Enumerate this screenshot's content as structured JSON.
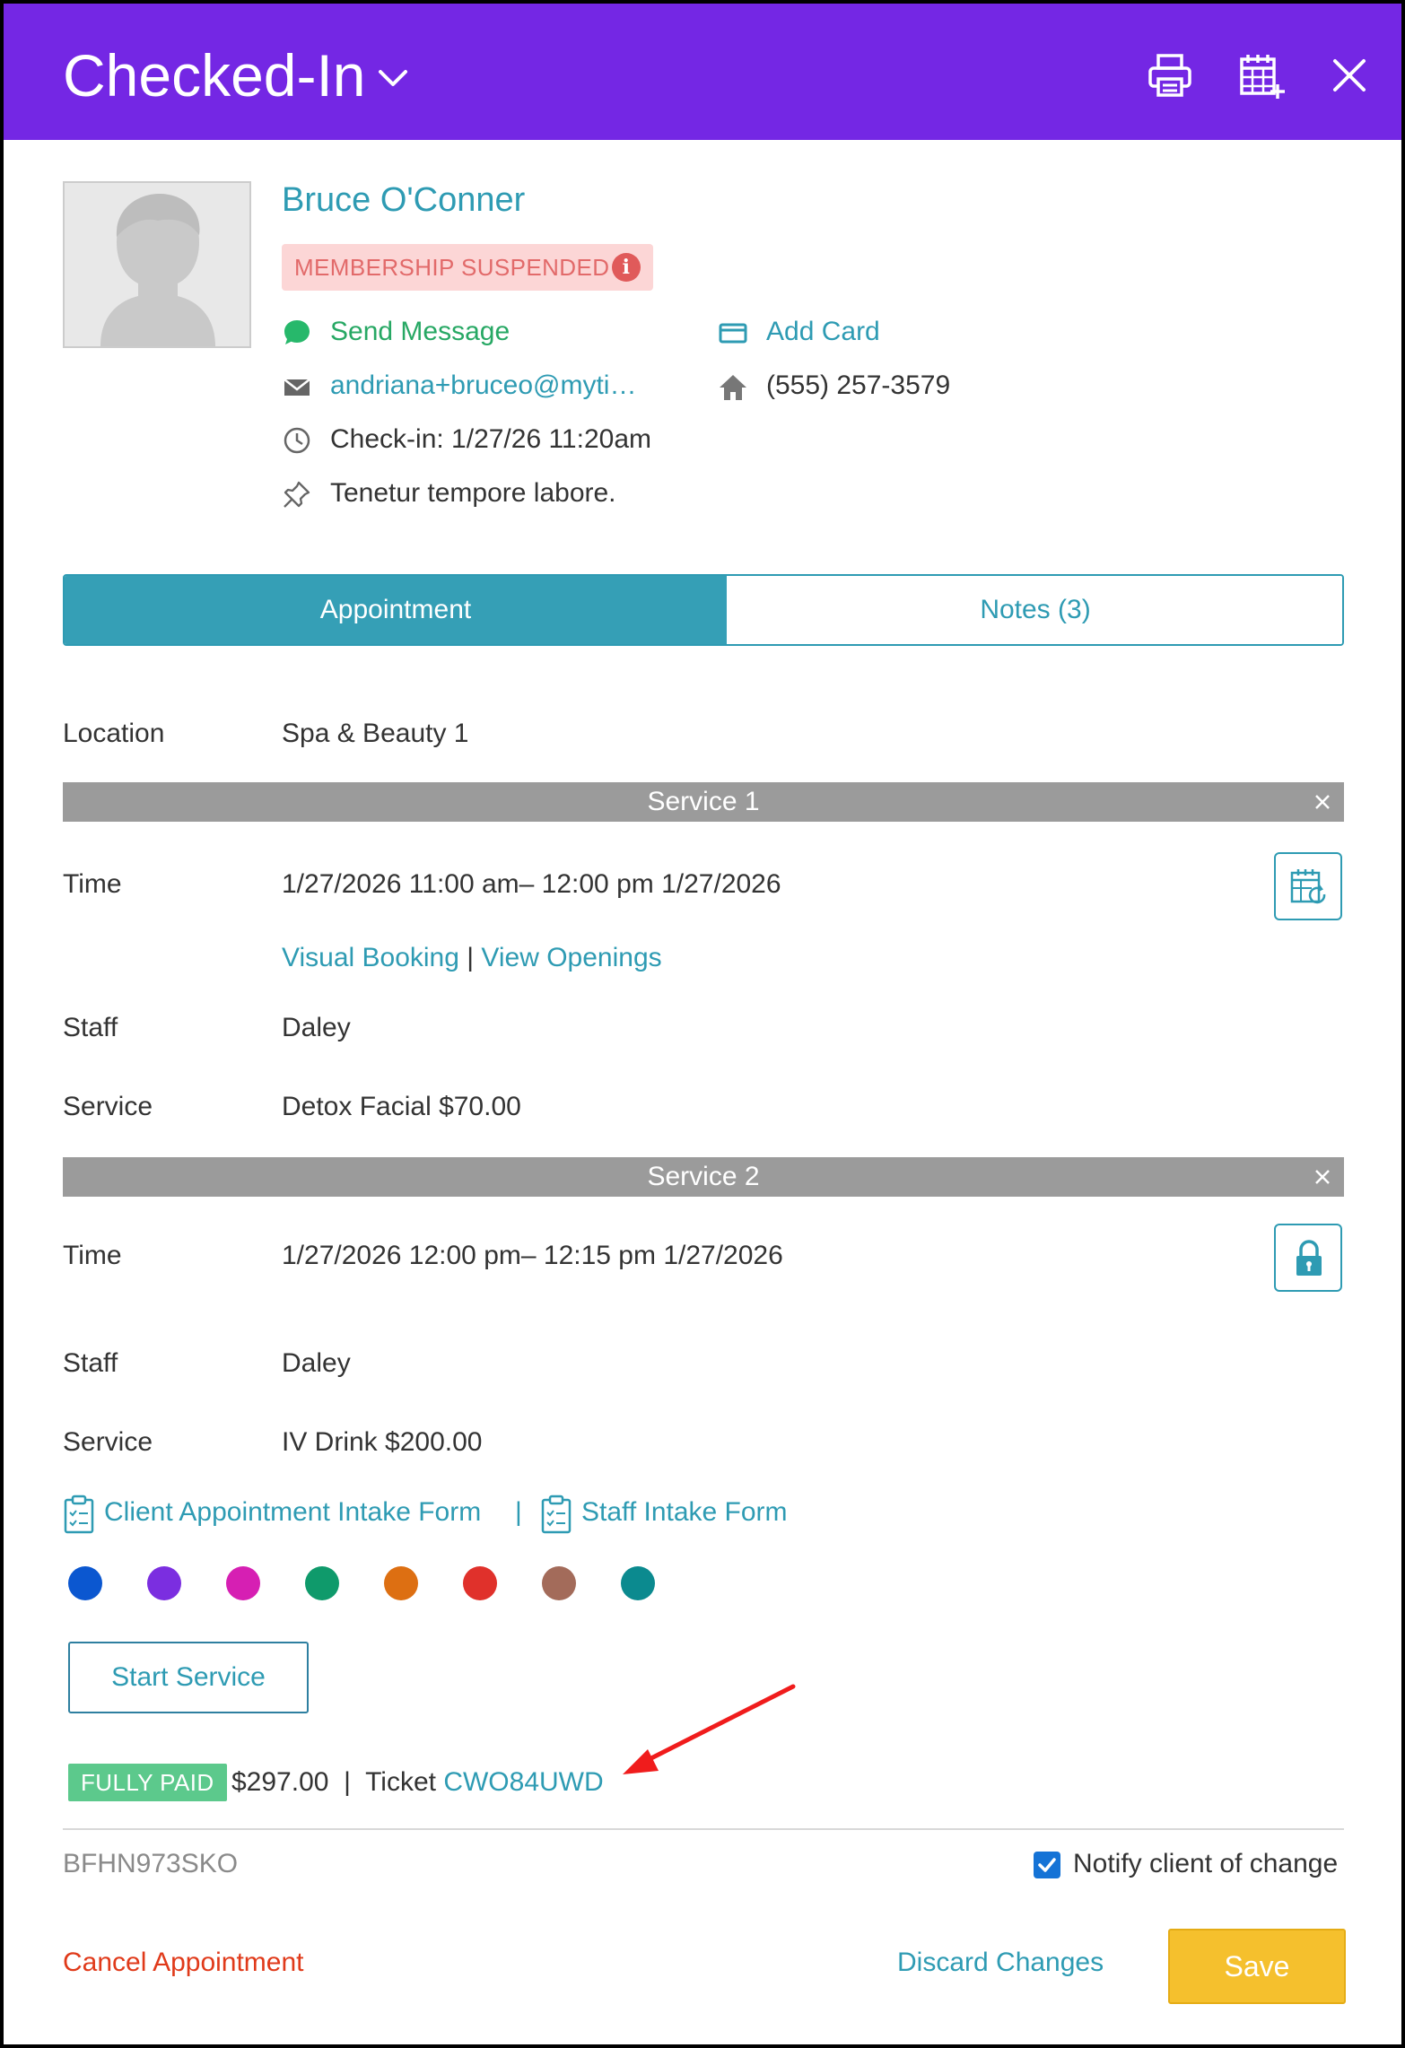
{
  "header": {
    "title": "Checked-In"
  },
  "client": {
    "name": "Bruce O'Conner",
    "membership_badge": "MEMBERSHIP SUSPENDED",
    "send_message": "Send Message",
    "add_card": "Add Card",
    "email": "andriana+bruceo@myti…",
    "phone": "(555) 257-3579",
    "checkin": "Check-in: 1/27/26 11:20am",
    "pinned_note": "Tenetur tempore labore."
  },
  "tabs": {
    "appointment": "Appointment",
    "notes": "Notes (3)"
  },
  "labels": {
    "location": "Location",
    "time": "Time",
    "staff": "Staff",
    "service": "Service"
  },
  "location": "Spa & Beauty 1",
  "services": [
    {
      "header": "Service 1",
      "time": "1/27/2026 11:00 am– 12:00 pm 1/27/2026",
      "visual_booking": "Visual Booking",
      "separator": "|",
      "view_openings": "View Openings",
      "staff": "Daley",
      "service": "Detox Facial  $70.00"
    },
    {
      "header": "Service 2",
      "time": "1/27/2026 12:00 pm– 12:15 pm 1/27/2026",
      "staff": "Daley",
      "service": "IV Drink  $200.00"
    }
  ],
  "forms": {
    "client_intake": "Client Appointment Intake Form",
    "separator": "|",
    "staff_intake": "Staff Intake Form"
  },
  "color_tags": [
    "#0b57d0",
    "#7b2ee0",
    "#d61fb3",
    "#0f9a6b",
    "#dd6f12",
    "#e0312b",
    "#a36b5a",
    "#0b8a8f"
  ],
  "start_service": "Start Service",
  "payment": {
    "status": "FULLY PAID",
    "amount": "$297.00",
    "separator": "|",
    "ticket_label": "Ticket",
    "ticket_id": "CWO84UWD"
  },
  "appointment_code": "BFHN973SKO",
  "notify": {
    "label": "Notify client of change",
    "checked": true
  },
  "actions": {
    "cancel": "Cancel Appointment",
    "discard": "Discard Changes",
    "save": "Save"
  },
  "colors": {
    "header": "#7427e4",
    "accent": "#2e9bb3",
    "save": "#f5c02d",
    "cancel": "#e03a1a",
    "paid": "#5cc98c"
  }
}
